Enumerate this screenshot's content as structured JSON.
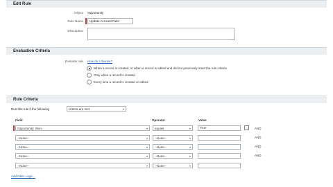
{
  "edit_rule": {
    "title": "Edit Rule",
    "object_label": "Object",
    "object_value": "Opportunity",
    "rule_name_label": "Rule Name",
    "rule_name_value": "Update Account Field",
    "description_label": "Description",
    "description_value": ""
  },
  "evaluation": {
    "title": "Evaluation Criteria",
    "evaluate_label": "Evaluate rule",
    "help_link": "How do I choose?",
    "options": [
      "When a record is created, or when a record is edited and did not previously meet the rule criteria",
      "Only when a record is created",
      "Every time a record is created or edited"
    ],
    "selected_index": 0
  },
  "rule_criteria": {
    "title": "Rule Criteria",
    "run_label": "Run this rule if the following",
    "run_select": "criteria are met",
    "columns": {
      "field": "Field",
      "operator": "Operator",
      "value": "Value"
    },
    "rows": [
      {
        "field": "Opportunity: Won",
        "operator": "equals",
        "value": "True",
        "and": "AND"
      },
      {
        "field": "--None--",
        "operator": "--None--",
        "value": "",
        "and": "AND"
      },
      {
        "field": "--None--",
        "operator": "--None--",
        "value": "",
        "and": "AND"
      },
      {
        "field": "--None--",
        "operator": "--None--",
        "value": "",
        "and": "AND"
      },
      {
        "field": "--None--",
        "operator": "--None--",
        "value": "",
        "and": ""
      }
    ],
    "add_filter_logic": "Add Filter Logic..."
  }
}
